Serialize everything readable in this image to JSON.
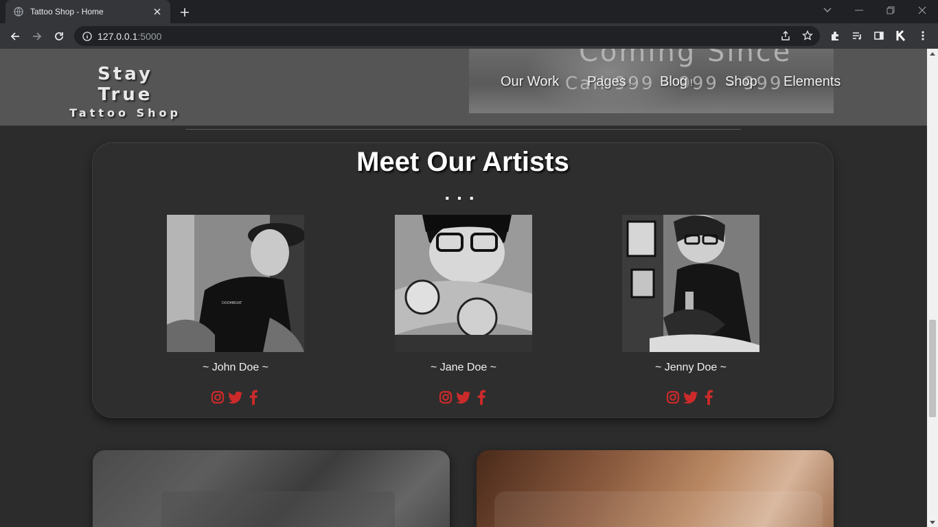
{
  "browser": {
    "tab_title": "Tattoo Shop - Home",
    "url_host": "127.0.0.1",
    "url_port": ":5000"
  },
  "site": {
    "brand_line1": "Stay True",
    "brand_line2": "Tattoo Shop",
    "hero_text_top": "Coming Since",
    "hero_text_call": "Call 999 - 999 - 999",
    "nav": [
      {
        "label": "Our Work"
      },
      {
        "label": "Pages",
        "caret": "!"
      },
      {
        "label": "Blog",
        "caret": "!"
      },
      {
        "label": "Shop"
      },
      {
        "label": "Elements"
      }
    ]
  },
  "artists": {
    "title": "Meet Our Artists",
    "dots": "...",
    "list": [
      {
        "name": "~ John Doe ~"
      },
      {
        "name": "~ Jane Doe ~"
      },
      {
        "name": "~ Jenny Doe ~"
      }
    ]
  },
  "colors": {
    "accent": "#cc2a2a",
    "header_bg": "#555555",
    "page_bg": "#2c2c2c"
  }
}
